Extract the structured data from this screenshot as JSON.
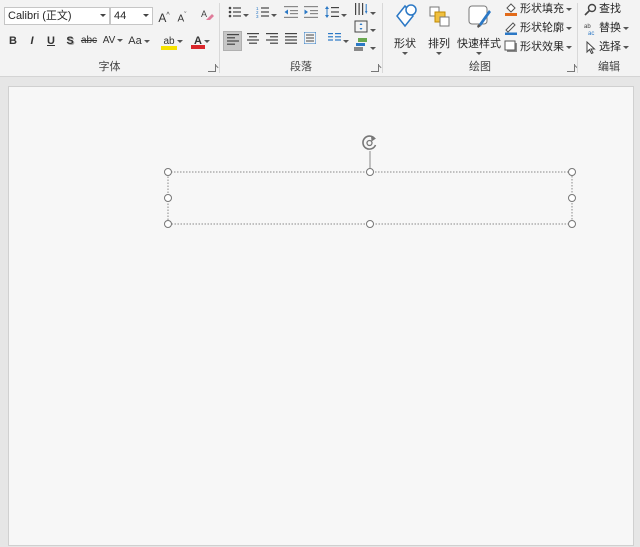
{
  "font": {
    "group_label": "字体",
    "font_name": "Calibri (正文)",
    "font_size": "44",
    "grow_label": "A",
    "shrink_label": "A",
    "bold_label": "B",
    "italic_label": "I",
    "underline_label": "U",
    "shadow_label": "S",
    "strike_label": "abc",
    "spacing_label": "AV",
    "case_label": "Aa",
    "highlight_label": "ab",
    "color_label": "A",
    "highlight_color": "#f6e200",
    "font_color": "#d9262b"
  },
  "paragraph": {
    "group_label": "段落"
  },
  "drawing": {
    "group_label": "绘图",
    "shapes_label": "形状",
    "arrange_label": "排列",
    "styles_label": "快速样式",
    "fill_label": "形状填充",
    "outline_label": "形状轮廓",
    "effects_label": "形状效果"
  },
  "editing": {
    "group_label": "编辑",
    "find_label": "查找",
    "replace_label": "替换",
    "select_label": "选择"
  },
  "colors": {
    "accent_blue": "#2b78c5",
    "ribbon_bg": "#f3f3f3"
  }
}
